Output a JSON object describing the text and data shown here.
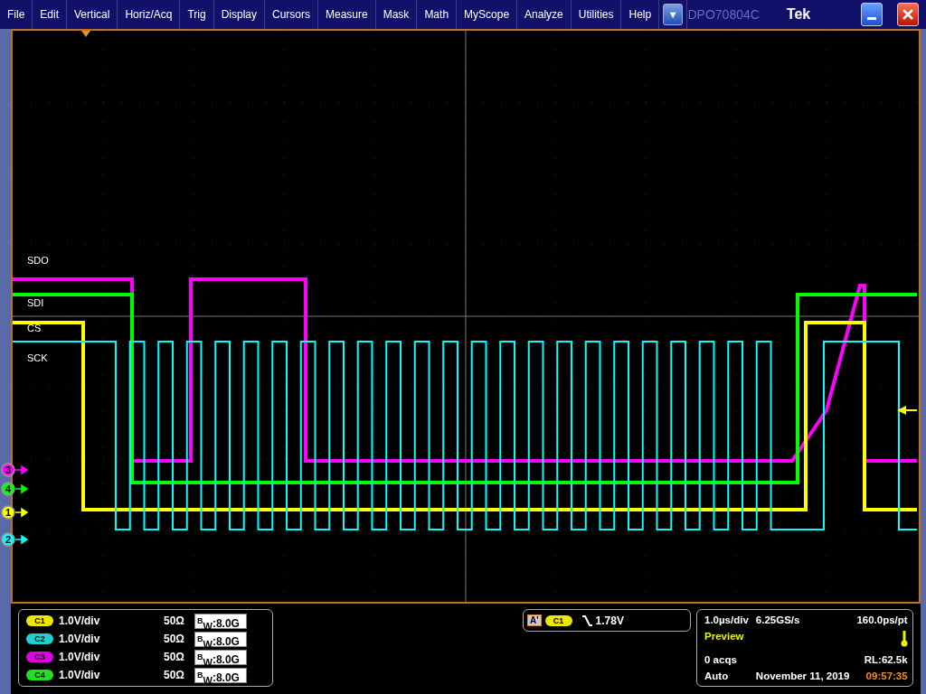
{
  "menu_bar": {
    "items": [
      "File",
      "Edit",
      "Vertical",
      "Horiz/Acq",
      "Trig",
      "Display",
      "Cursors",
      "Measure",
      "Mask",
      "Math",
      "MyScope",
      "Analyze",
      "Utilities",
      "Help"
    ],
    "dropdown": "▼",
    "model": "DPO70804C",
    "brand": "Tek"
  },
  "display": {
    "trace_labels": [
      "SDO",
      "SDI",
      "CS",
      "SCK"
    ],
    "channel_markers": [
      {
        "label": "3",
        "color": "#ff00ff"
      },
      {
        "label": "4",
        "color": "#00ff00"
      },
      {
        "label": "1",
        "color": "#ffff00"
      },
      {
        "label": "2",
        "color": "#00ffff"
      }
    ]
  },
  "channels": [
    {
      "badge": "C1",
      "color": "#e8e800",
      "scale": "1.0V/div",
      "impedance": "50Ω",
      "bandwidth": "$^{B}$$_{W}$:8.0G"
    },
    {
      "badge": "C2",
      "color": "#20d0d0",
      "scale": "1.0V/div",
      "impedance": "50Ω",
      "bandwidth": "$^{B}$$_{W}$:8.0G"
    },
    {
      "badge": "C3",
      "color": "#e000e0",
      "scale": "1.0V/div",
      "impedance": "50Ω",
      "bandwidth": "$^{B}$$_{W}$:8.0G"
    },
    {
      "badge": "C4",
      "color": "#20e020",
      "scale": "1.0V/div",
      "impedance": "50Ω",
      "bandwidth": "$^{B}$$_{W}$:8.0G"
    }
  ],
  "trigger": {
    "event": "A'",
    "source": {
      "badge": "C1",
      "color": "#e8e800"
    },
    "level": "1.78V"
  },
  "acquisition": {
    "time_scale": "1.0µs/div",
    "sample_rate": "6.25GS/s",
    "resolution": "160.0ps/pt",
    "mode": "Preview",
    "acqs": "0 acqs",
    "record_length": "RL:62.5k",
    "trigger_mode": "Auto",
    "date": "November 11, 2019",
    "time": "09:57:35"
  }
}
